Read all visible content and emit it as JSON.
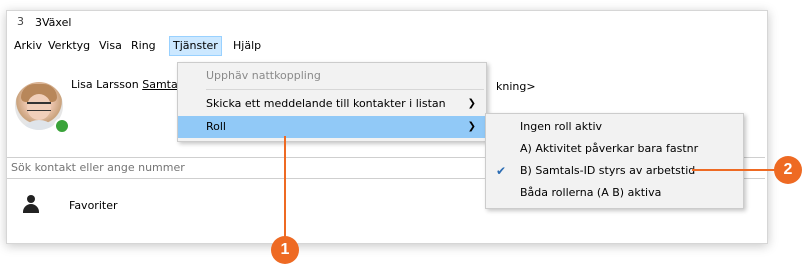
{
  "window": {
    "title": "3Växel",
    "logo_glyph": "3"
  },
  "menubar": {
    "items": [
      "Arkiv",
      "Verktyg",
      "Visa",
      "Ring",
      "Tjänster",
      "Hjälp"
    ],
    "active": "Tjänster"
  },
  "user": {
    "name": "Lisa Larsson",
    "link_text": "Samtals",
    "right_text": "kning>",
    "status_color": "#3aa33a"
  },
  "search": {
    "placeholder": "Sök kontakt eller ange nummer"
  },
  "favorites": {
    "label": "Favoriter"
  },
  "tjanster_menu": {
    "items": [
      {
        "label": "Upphäv nattkoppling",
        "disabled": true
      },
      {
        "label": "Skicka ett meddelande till kontakter i listan",
        "has_submenu": true
      },
      {
        "label": "Roll",
        "has_submenu": true,
        "highlighted": true
      }
    ]
  },
  "roll_submenu": {
    "items": [
      {
        "label": "Ingen roll aktiv"
      },
      {
        "label": "A) Aktivitet påverkar bara fastnr"
      },
      {
        "label": "B) Samtals-ID styrs av arbetstid",
        "checked": true
      },
      {
        "label": "Båda rollerna (A  B) aktiva"
      }
    ]
  },
  "callouts": [
    {
      "number": "1"
    },
    {
      "number": "2"
    }
  ],
  "colors": {
    "accent": "#ee6a23",
    "highlight": "#91c9f7",
    "menu_active": "#cce8ff"
  }
}
